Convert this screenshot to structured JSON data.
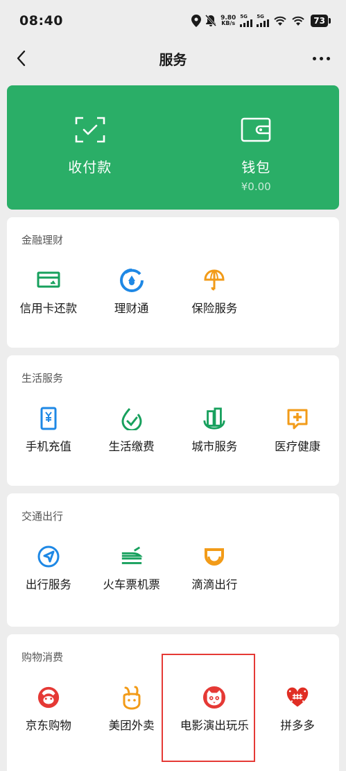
{
  "status_bar": {
    "time": "08:40",
    "net_speed_value": "9.80",
    "net_speed_unit": "KB/s",
    "sim1_label": "5G",
    "sim2_label": "5G",
    "battery": "73"
  },
  "nav": {
    "title": "服务"
  },
  "pay_card": {
    "color": "#2aae67",
    "items": [
      {
        "label": "收付款",
        "icon": "scan-check-icon"
      },
      {
        "label": "钱包",
        "icon": "wallet-icon",
        "sub": "¥0.00"
      }
    ]
  },
  "sections": [
    {
      "title": "金融理财",
      "items": [
        {
          "label": "信用卡还款",
          "icon": "credit-card-icon",
          "color": "#17a05d"
        },
        {
          "label": "理财通",
          "icon": "wealth-icon",
          "color": "#1e88e5"
        },
        {
          "label": "保险服务",
          "icon": "insurance-umbrella-icon",
          "color": "#f29b18"
        }
      ]
    },
    {
      "title": "生活服务",
      "items": [
        {
          "label": "手机充值",
          "icon": "phone-recharge-icon",
          "color": "#1e88e5"
        },
        {
          "label": "生活缴费",
          "icon": "bill-payment-icon",
          "color": "#17a05d"
        },
        {
          "label": "城市服务",
          "icon": "city-buildings-icon",
          "color": "#17a05d"
        },
        {
          "label": "医疗健康",
          "icon": "medical-icon",
          "color": "#f29b18"
        }
      ]
    },
    {
      "title": "交通出行",
      "items": [
        {
          "label": "出行服务",
          "icon": "navigation-icon",
          "color": "#1e88e5"
        },
        {
          "label": "火车票机票",
          "icon": "train-plane-icon",
          "color": "#17a05d"
        },
        {
          "label": "滴滴出行",
          "icon": "didi-icon",
          "color": "#f29b18"
        }
      ]
    },
    {
      "title": "购物消费",
      "items": [
        {
          "label": "京东购物",
          "icon": "jd-dog-icon",
          "color": "#e53935"
        },
        {
          "label": "美团外卖",
          "icon": "meituan-rabbit-icon",
          "color": "#f29b18"
        },
        {
          "label": "电影演出玩乐",
          "icon": "maoyan-cat-icon",
          "color": "#e53935"
        },
        {
          "label": "拼多多",
          "icon": "pinduoduo-heart-icon",
          "color": "#e02e24"
        }
      ]
    }
  ]
}
